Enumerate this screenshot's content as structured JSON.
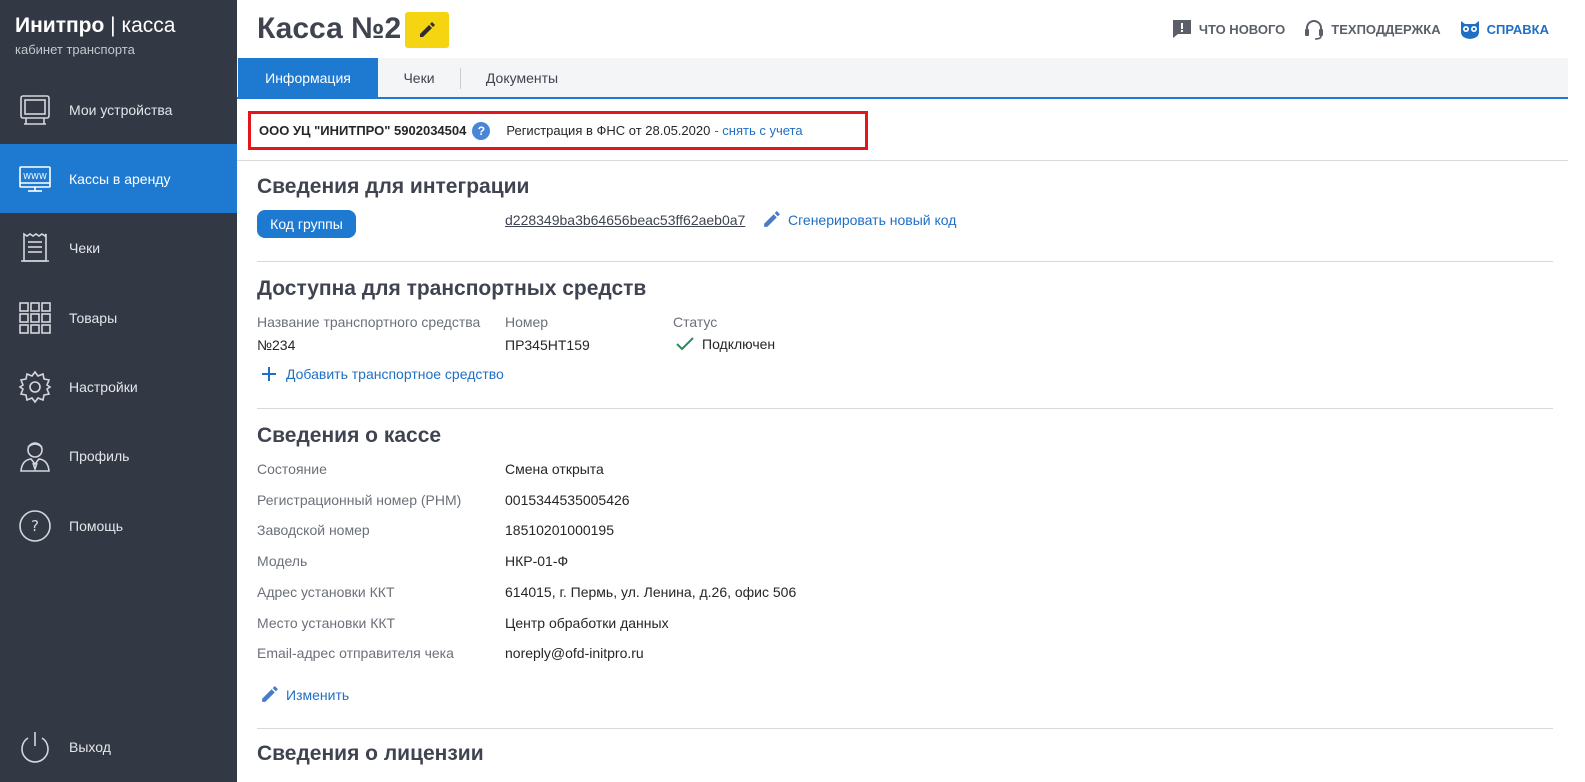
{
  "sidebar": {
    "brand_name": "Инитпро",
    "brand_product": "касса",
    "brand_separator": "|",
    "brand_subtitle": "кабинет транспорта",
    "items": [
      {
        "label": "Мои устройства",
        "icon": "device-icon"
      },
      {
        "label": "Кассы в аренду",
        "icon": "www-monitor-icon",
        "active": true
      },
      {
        "label": "Чеки",
        "icon": "receipt-icon"
      },
      {
        "label": "Товары",
        "icon": "grid-icon"
      },
      {
        "label": "Настройки",
        "icon": "gear-icon"
      },
      {
        "label": "Профиль",
        "icon": "user-icon"
      },
      {
        "label": "Помощь",
        "icon": "question-icon"
      }
    ],
    "logout_label": "Выход"
  },
  "header": {
    "title": "Касса №2",
    "links": {
      "whats_new": "ЧТО НОВОГО",
      "support": "ТЕХПОДДЕРЖКА",
      "help": "СПРАВКА"
    }
  },
  "tabs": [
    {
      "label": "Информация",
      "active": true
    },
    {
      "label": "Чеки"
    },
    {
      "label": "Документы"
    }
  ],
  "org": {
    "name": "ООО УЦ \"ИНИТПРО\" 5902034504",
    "help_glyph": "?",
    "registration": "Регистрация в ФНС от 28.05.2020",
    "unregister_link": "- снять с учета"
  },
  "integration": {
    "title": "Сведения для интеграции",
    "group_badge": "Код группы",
    "code": "d228349ba3b64656beac53ff62aeb0a7",
    "generate_link": "Сгенерировать новый код"
  },
  "vehicles": {
    "title": "Доступна для транспортных средств",
    "col_name": "Название транспортного средства",
    "col_number": "Номер",
    "col_status": "Статус",
    "row": {
      "name": "№234",
      "number": "ПР345НТ159",
      "status": "Подключен"
    },
    "add_link": "Добавить транспортное средство"
  },
  "kassa": {
    "title": "Сведения о кассе",
    "rows": [
      {
        "label": "Состояние",
        "value": "Смена открыта"
      },
      {
        "label": "Регистрационный номер (РНМ)",
        "value": "0015344535005426"
      },
      {
        "label": "Заводской номер",
        "value": "18510201000195"
      },
      {
        "label": "Модель",
        "value": "НКР-01-Ф"
      },
      {
        "label": "Адрес установки ККТ",
        "value": "614015, г. Пермь, ул. Ленина, д.26, офис 506"
      },
      {
        "label": "Место установки ККТ",
        "value": "Центр обработки данных"
      },
      {
        "label": "Email-адрес отправителя чека",
        "value": "noreply@ofd-initpro.ru"
      }
    ],
    "edit_link": "Изменить"
  },
  "license": {
    "title": "Сведения о лицензии"
  },
  "colors": {
    "sidebar_bg": "#333845",
    "accent": "#1e7ad1",
    "edit_yellow": "#f5d511",
    "highlight_red": "#e3161c",
    "link": "#1f6fc5"
  }
}
